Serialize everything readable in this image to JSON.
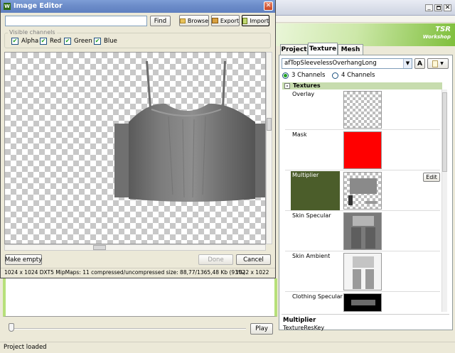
{
  "editor": {
    "title": "Image Editor",
    "search_value": "",
    "find_label": "Find",
    "browse_label": "Browse",
    "export_label": "Export",
    "import_label": "Import",
    "visible_channels_label": "Visible channels",
    "channels": [
      {
        "label": "Alpha",
        "checked": true
      },
      {
        "label": "Red",
        "checked": true
      },
      {
        "label": "Green",
        "checked": true
      },
      {
        "label": "Blue",
        "checked": true
      }
    ],
    "make_empty_label": "Make empty",
    "done_label": "Done",
    "cancel_label": "Cancel",
    "status_info": "1024 x 1024 DXT5 MipMaps: 11 compressed/uncompressed size: 88,77/1365,48 Kb (93%)",
    "status_size": "1022 x 1022"
  },
  "main": {
    "logo_line1": "TSR",
    "logo_line2": "Workshop",
    "tabs": [
      {
        "label": "Project",
        "active": false
      },
      {
        "label": "Texture",
        "active": true
      },
      {
        "label": "Mesh",
        "active": false
      }
    ],
    "texture_select_value": "afTopSleevelessOverhangLong",
    "channel_options": [
      {
        "label": "3 Channels",
        "selected": true
      },
      {
        "label": "4 Channels",
        "selected": false
      }
    ],
    "textures_group_label": "Textures",
    "textures": [
      {
        "label": "Overlay",
        "swatch": "checker"
      },
      {
        "label": "Mask",
        "swatch": "red"
      },
      {
        "label": "Multiplier",
        "swatch": "garment",
        "selected": true,
        "edit_label": "Edit"
      },
      {
        "label": "Skin Specular",
        "swatch": "body-gray"
      },
      {
        "label": "Skin Ambient",
        "swatch": "body-light"
      },
      {
        "label": "Clothing Specular",
        "swatch": "dark"
      }
    ],
    "info_title": "Multiplier",
    "info_text": "TextureResKey",
    "play_label": "Play",
    "status_text": "Project loaded"
  },
  "colors": {
    "selected_row": "#4b5d2a",
    "group_header": "#c7dcae",
    "mask_red": "#ff0000",
    "title_blue": "#0a246a"
  }
}
